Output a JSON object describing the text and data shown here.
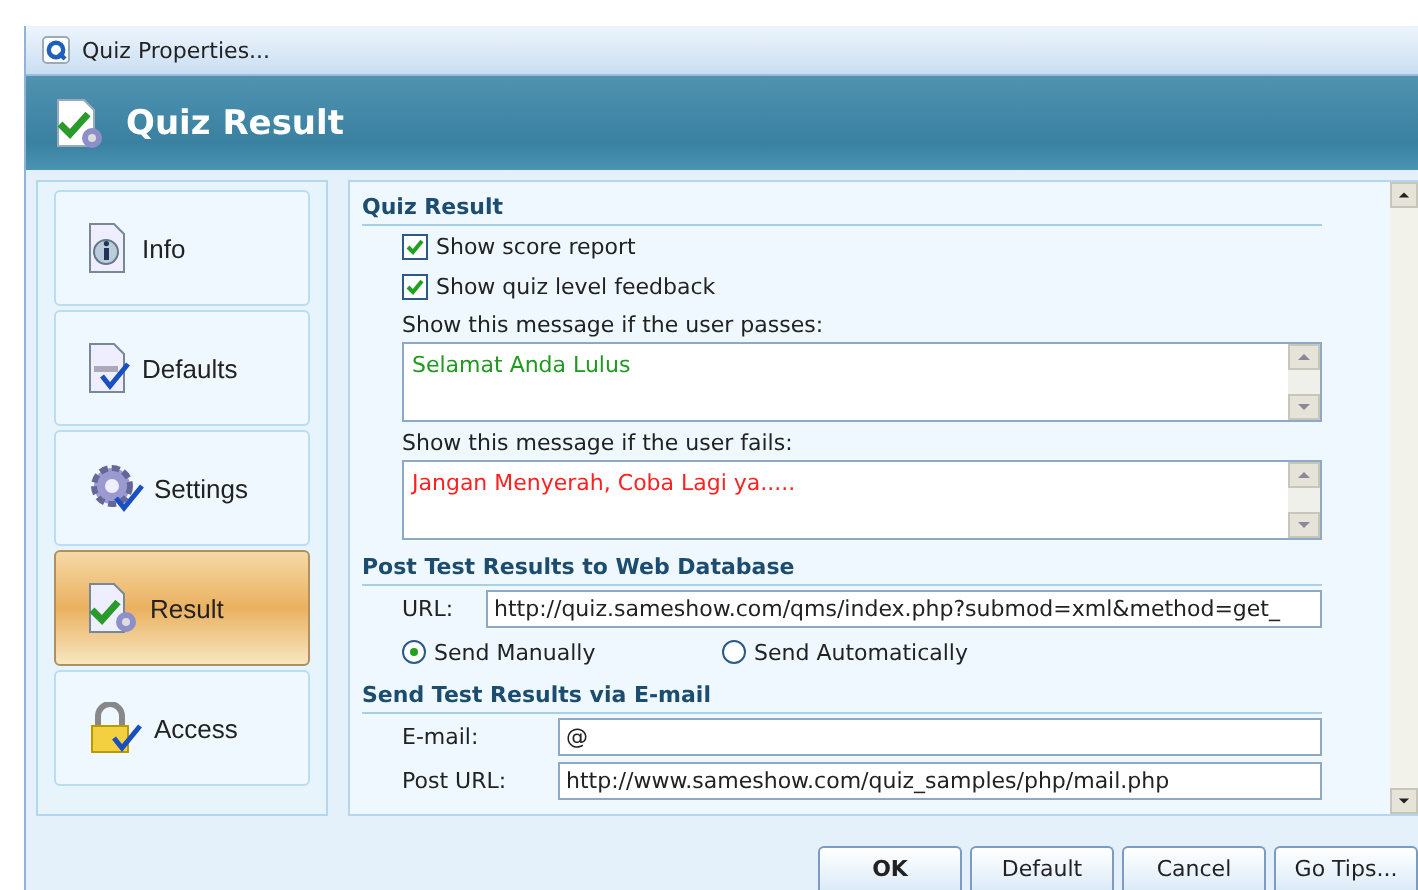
{
  "window": {
    "title": "Quiz Properties..."
  },
  "header": {
    "title": "Quiz Result"
  },
  "sidebar": {
    "items": [
      {
        "label": "Info",
        "selected": false
      },
      {
        "label": "Defaults",
        "selected": false
      },
      {
        "label": "Settings",
        "selected": false
      },
      {
        "label": "Result",
        "selected": true
      },
      {
        "label": "Access",
        "selected": false
      }
    ]
  },
  "quiz_result": {
    "title": "Quiz Result",
    "checkboxes": [
      {
        "label": "Show score report",
        "checked": true
      },
      {
        "label": "Show quiz level feedback",
        "checked": true
      }
    ],
    "messages": [
      {
        "label": "Show this message if the user passes:",
        "value": "Selamat Anda Lulus",
        "color": "#1e9a1e"
      },
      {
        "label": "Show this message if the user fails:",
        "value": "Jangan Menyerah, Coba Lagi ya.....",
        "color": "#ff2020"
      }
    ]
  },
  "web_database": {
    "title": "Post Test Results to Web Database",
    "url_label": "URL:",
    "url": "http://quiz.sameshow.com/qms/index.php?submod=xml&method=get_",
    "options": [
      {
        "label": "Send Manually",
        "selected": true
      },
      {
        "label": "Send Automatically",
        "selected": false
      }
    ]
  },
  "email": {
    "title": "Send Test Results via E-mail",
    "fields": [
      {
        "label": "E-mail:",
        "value": "@"
      },
      {
        "label": "Post URL:",
        "value": "http://www.sameshow.com/quiz_samples/php/mail.php"
      }
    ]
  },
  "buttons": [
    "OK",
    "Default",
    "Cancel",
    "Go Tips..."
  ]
}
